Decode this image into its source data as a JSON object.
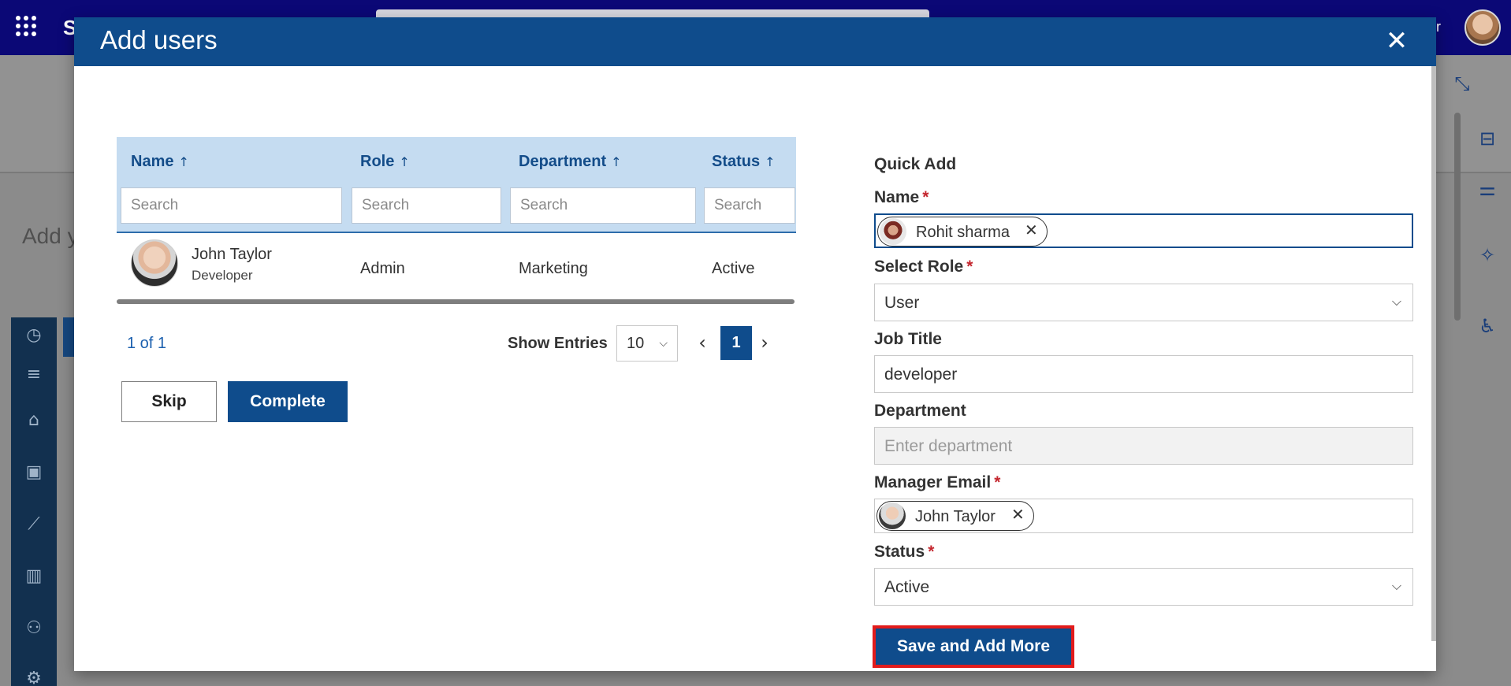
{
  "background": {
    "user_name_partial": "or",
    "heading_partial": "Add y",
    "brand_partial": "S"
  },
  "modal": {
    "title": "Add users",
    "close_icon": "close-icon"
  },
  "table": {
    "columns": [
      {
        "label": "Name",
        "sort": "↑",
        "placeholder": "Search"
      },
      {
        "label": "Role",
        "sort": "↑",
        "placeholder": "Search"
      },
      {
        "label": "Department",
        "sort": "↑",
        "placeholder": "Search"
      },
      {
        "label": "Status",
        "sort": "↑",
        "placeholder": "Search"
      }
    ],
    "rows": [
      {
        "name": "John Taylor",
        "title": "Developer",
        "role": "Admin",
        "department": "Marketing",
        "status": "Active"
      }
    ]
  },
  "pager": {
    "count": "1 of 1",
    "show_entries_label": "Show Entries",
    "entries": "10",
    "current_page": "1"
  },
  "actions": {
    "skip": "Skip",
    "complete": "Complete"
  },
  "quick_add": {
    "title": "Quick Add",
    "name": {
      "label": "Name",
      "required": "*",
      "value": "Rohit sharma"
    },
    "role": {
      "label": "Select Role",
      "required": "*",
      "value": "User"
    },
    "job_title": {
      "label": "Job Title",
      "value": "developer"
    },
    "department": {
      "label": "Department",
      "placeholder": "Enter department"
    },
    "manager_email": {
      "label": "Manager Email",
      "required": "*",
      "value": "John Taylor"
    },
    "status": {
      "label": "Status",
      "required": "*",
      "value": "Active"
    },
    "save_button": "Save and Add More"
  },
  "colors": {
    "primary": "#0f4c8c",
    "header_row": "#c5dcf1",
    "required": "#c4262e",
    "highlight": "#e21b1b"
  }
}
